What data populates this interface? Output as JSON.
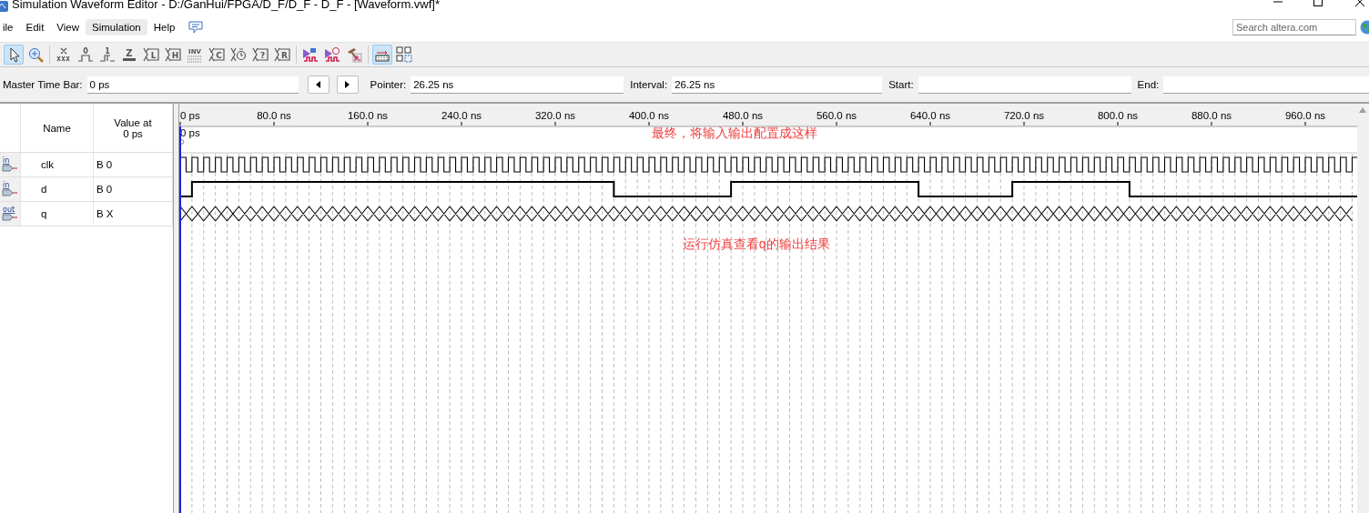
{
  "window": {
    "title": "Simulation Waveform Editor - D:/GanHui/FPGA/D_F/D_F - D_F - [Waveform.vwf]*"
  },
  "menu": [
    {
      "label": "ile",
      "highlighted": false
    },
    {
      "label": "Edit",
      "highlighted": false
    },
    {
      "label": "View",
      "highlighted": false
    },
    {
      "label": "Simulation",
      "highlighted": true
    },
    {
      "label": "Help",
      "highlighted": false
    }
  ],
  "search": {
    "placeholder": "Search altera.com"
  },
  "toolbar": [
    {
      "kind": "pointer",
      "selected": true
    },
    {
      "kind": "zoom",
      "selected": false
    },
    {
      "kind": "separator"
    },
    {
      "kind": "unknown",
      "selected": false
    },
    {
      "kind": "low",
      "glyph": "0",
      "selected": false
    },
    {
      "kind": "high",
      "glyph": "1",
      "selected": false
    },
    {
      "kind": "hiz",
      "glyph": "Z",
      "selected": false
    },
    {
      "kind": "xletter",
      "glyph": "L",
      "selected": false
    },
    {
      "kind": "xletter",
      "glyph": "H",
      "selected": false
    },
    {
      "kind": "inv",
      "glyph": "INV",
      "selected": false
    },
    {
      "kind": "xletter",
      "glyph": "C",
      "selected": false
    },
    {
      "kind": "timer",
      "selected": false
    },
    {
      "kind": "xletter",
      "glyph": "?",
      "selected": false
    },
    {
      "kind": "xletter",
      "glyph": "R",
      "selected": false
    },
    {
      "kind": "separator"
    },
    {
      "kind": "run",
      "selected": false
    },
    {
      "kind": "run-timing",
      "selected": false
    },
    {
      "kind": "build",
      "selected": false
    },
    {
      "kind": "separator"
    },
    {
      "kind": "snap",
      "selected": true
    },
    {
      "kind": "select-all",
      "selected": false
    }
  ],
  "time_bar": {
    "master_label": "Master Time Bar:",
    "master_value": "0 ps",
    "pointer_label": "Pointer:",
    "pointer_value": "26.25 ns",
    "interval_label": "Interval:",
    "interval_value": "26.25 ns",
    "start_label": "Start:",
    "end_label": "End:"
  },
  "signal_list": {
    "columns": [
      "Name",
      "Value at 0 ps"
    ],
    "signals": [
      {
        "direction": "in",
        "name": "clk",
        "value": "B 0",
        "kind": "clock"
      },
      {
        "direction": "in",
        "name": "d",
        "value": "B 0",
        "kind": "pulses"
      },
      {
        "direction": "out",
        "name": "q",
        "value": "B X",
        "kind": "unknown"
      }
    ]
  },
  "waveform": {
    "ruler": [
      "0 ps",
      "80.0 ns",
      "160.0 ns",
      "240.0 ns",
      "320.0 ns",
      "400.0 ns",
      "480.0 ns",
      "560.0 ns",
      "640.0 ns",
      "720.0 ns",
      "800.0 ns",
      "880.0 ns",
      "960.0 ns"
    ],
    "marker": "0 ps",
    "annotations": [
      "最终，将输入输出配置成这样",
      "运行仿真查看q的输出结果"
    ]
  }
}
